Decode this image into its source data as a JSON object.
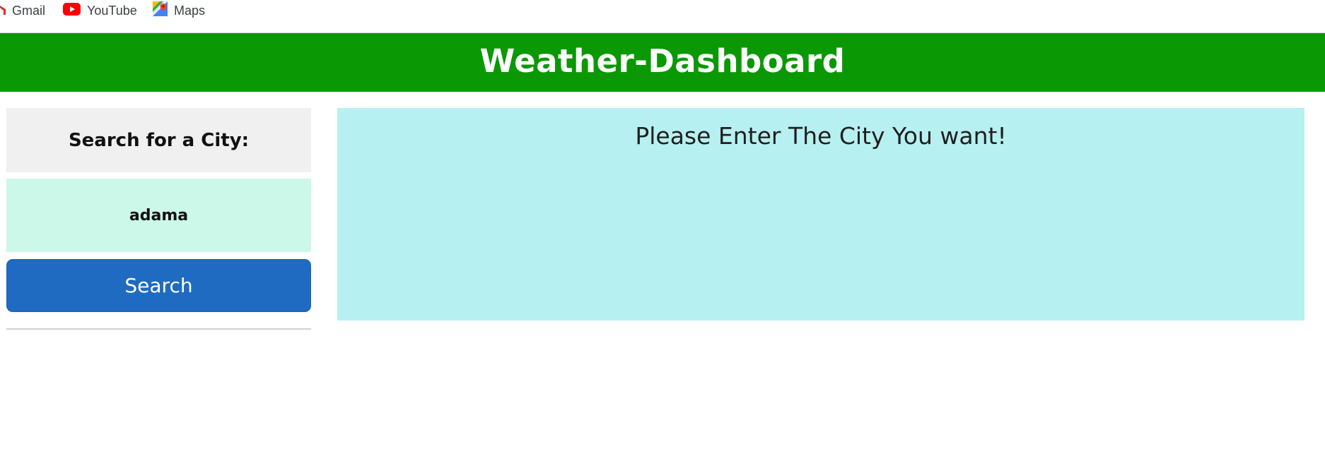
{
  "bookmarks": [
    {
      "label": "Gmail",
      "icon": "gmail-icon"
    },
    {
      "label": "YouTube",
      "icon": "youtube-icon"
    },
    {
      "label": "Maps",
      "icon": "maps-icon"
    }
  ],
  "header": {
    "title": "Weather-Dashboard",
    "background": "#0a9904"
  },
  "sidebar": {
    "heading": "Search for a City:",
    "city_input_value": "adama",
    "search_button_label": "Search",
    "button_color": "#1f6bc1",
    "input_background": "#cbf8e8"
  },
  "main": {
    "message": "Please Enter The City You want!",
    "panel_background": "#b7f0f0"
  }
}
